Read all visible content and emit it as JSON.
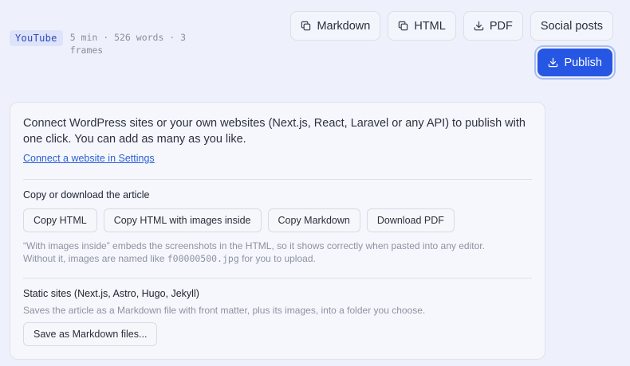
{
  "meta": {
    "source_badge": "YouTube",
    "stats": "5 min · 526 words · 3 frames"
  },
  "toolbar": {
    "markdown_label": "Markdown",
    "html_label": "HTML",
    "pdf_label": "PDF",
    "social_label": "Social posts",
    "publish_label": "Publish"
  },
  "panel": {
    "intro": "Connect WordPress sites or your own websites (Next.js, React, Laravel or any API) to publish with one click. You can add as many as you like.",
    "connect_link": "Connect a website in Settings",
    "copy_section": {
      "title": "Copy or download the article",
      "buttons": [
        "Copy HTML",
        "Copy HTML with images inside",
        "Copy Markdown",
        "Download PDF"
      ],
      "note_line1": "“With images inside” embeds the screenshots in the HTML, so it shows correctly when pasted into any editor.",
      "note_line2_before": "Without it, images are named like ",
      "note_code": "f00000500.jpg",
      "note_line2_after": " for you to upload."
    },
    "static_section": {
      "title": "Static sites (Next.js, Astro, Hugo, Jekyll)",
      "description": "Saves the article as a Markdown file with front matter, plus its images, into a folder you choose.",
      "button": "Save as Markdown files..."
    }
  },
  "colors": {
    "background": "#eef1fb",
    "accent": "#2657e4",
    "badge_bg": "#dde3fb",
    "link": "#2b5fd6"
  },
  "icons": {
    "markdown": "copy-icon",
    "html": "copy-icon",
    "pdf": "download-icon",
    "publish": "download-icon"
  }
}
